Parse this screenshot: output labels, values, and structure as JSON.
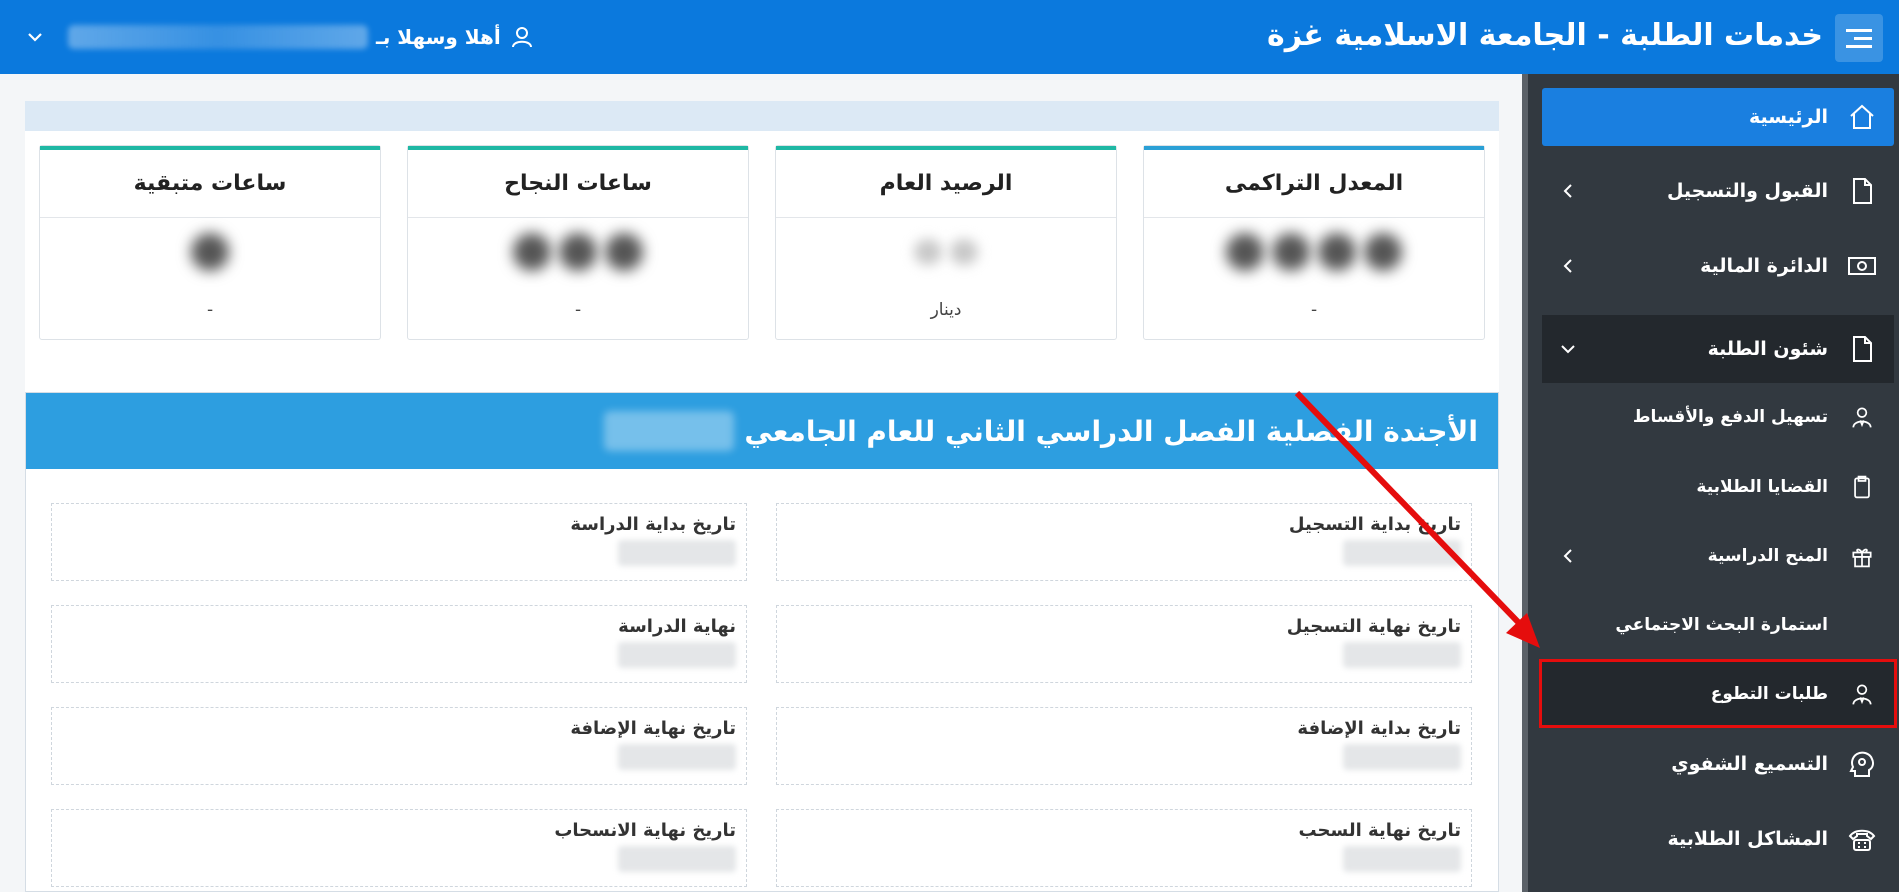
{
  "header": {
    "title": "خدمات الطلبة - الجامعة الاسلامية غزة",
    "welcome": "أهلا وسهلا بـ"
  },
  "stats": [
    {
      "title": "المعدل التراكمى",
      "footer": "-"
    },
    {
      "title": "الرصيد العام",
      "footer": "دينار"
    },
    {
      "title": "ساعات النجاح",
      "footer": "-"
    },
    {
      "title": "ساعات متبقية",
      "footer": "-"
    }
  ],
  "agenda": {
    "title": "الأجندة الفصلية الفصل الدراسي الثاني للعام الجامعي",
    "fields": [
      {
        "label": "تاريخ بداية التسجيل"
      },
      {
        "label": "تاريخ بداية الدراسة"
      },
      {
        "label": "تاريخ نهاية التسجيل"
      },
      {
        "label": "نهاية الدراسة"
      },
      {
        "label": "تاريخ بداية الإضافة"
      },
      {
        "label": "تاريخ نهاية الإضافة"
      },
      {
        "label": "تاريخ نهاية السحب"
      },
      {
        "label": "تاريخ نهاية الانسحاب"
      }
    ]
  },
  "sidebar": {
    "items": [
      {
        "label": "الرئيسية",
        "icon": "home-icon"
      },
      {
        "label": "القبول والتسجيل",
        "icon": "document-icon"
      },
      {
        "label": "الدائرة المالية",
        "icon": "money-icon"
      },
      {
        "label": "شئون الطلبة",
        "icon": "document-icon"
      },
      {
        "label": "تسهيل الدفع والأقساط",
        "icon": "user-tie-icon"
      },
      {
        "label": "القضايا الطلابية",
        "icon": "clipboard-icon"
      },
      {
        "label": "المنح الدراسية",
        "icon": "gift-icon"
      },
      {
        "label": "استمارة البحث الاجتماعي",
        "icon": ""
      },
      {
        "label": "طلبات التطوع",
        "icon": "user-tie-icon"
      },
      {
        "label": "التسميع الشفوي",
        "icon": "head-speech-icon"
      },
      {
        "label": "المشاكل الطلابية",
        "icon": "phone-icon"
      }
    ]
  },
  "colors": {
    "header": "#0b79dd",
    "sidebar": "#323940",
    "active": "#1a7fe0",
    "agenda_header": "#2d9ee0",
    "annotation": "#e50d0d"
  }
}
